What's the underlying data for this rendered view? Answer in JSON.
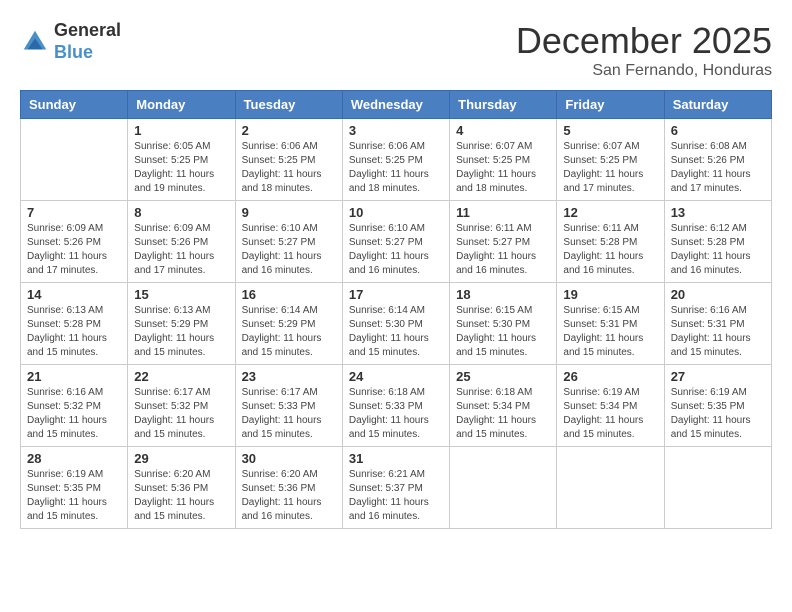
{
  "header": {
    "logo_general": "General",
    "logo_blue": "Blue",
    "month": "December 2025",
    "location": "San Fernando, Honduras"
  },
  "days_of_week": [
    "Sunday",
    "Monday",
    "Tuesday",
    "Wednesday",
    "Thursday",
    "Friday",
    "Saturday"
  ],
  "weeks": [
    [
      {
        "day": "",
        "sunrise": "",
        "sunset": "",
        "daylight": ""
      },
      {
        "day": "1",
        "sunrise": "Sunrise: 6:05 AM",
        "sunset": "Sunset: 5:25 PM",
        "daylight": "Daylight: 11 hours and 19 minutes."
      },
      {
        "day": "2",
        "sunrise": "Sunrise: 6:06 AM",
        "sunset": "Sunset: 5:25 PM",
        "daylight": "Daylight: 11 hours and 18 minutes."
      },
      {
        "day": "3",
        "sunrise": "Sunrise: 6:06 AM",
        "sunset": "Sunset: 5:25 PM",
        "daylight": "Daylight: 11 hours and 18 minutes."
      },
      {
        "day": "4",
        "sunrise": "Sunrise: 6:07 AM",
        "sunset": "Sunset: 5:25 PM",
        "daylight": "Daylight: 11 hours and 18 minutes."
      },
      {
        "day": "5",
        "sunrise": "Sunrise: 6:07 AM",
        "sunset": "Sunset: 5:25 PM",
        "daylight": "Daylight: 11 hours and 17 minutes."
      },
      {
        "day": "6",
        "sunrise": "Sunrise: 6:08 AM",
        "sunset": "Sunset: 5:26 PM",
        "daylight": "Daylight: 11 hours and 17 minutes."
      }
    ],
    [
      {
        "day": "7",
        "sunrise": "Sunrise: 6:09 AM",
        "sunset": "Sunset: 5:26 PM",
        "daylight": "Daylight: 11 hours and 17 minutes."
      },
      {
        "day": "8",
        "sunrise": "Sunrise: 6:09 AM",
        "sunset": "Sunset: 5:26 PM",
        "daylight": "Daylight: 11 hours and 17 minutes."
      },
      {
        "day": "9",
        "sunrise": "Sunrise: 6:10 AM",
        "sunset": "Sunset: 5:27 PM",
        "daylight": "Daylight: 11 hours and 16 minutes."
      },
      {
        "day": "10",
        "sunrise": "Sunrise: 6:10 AM",
        "sunset": "Sunset: 5:27 PM",
        "daylight": "Daylight: 11 hours and 16 minutes."
      },
      {
        "day": "11",
        "sunrise": "Sunrise: 6:11 AM",
        "sunset": "Sunset: 5:27 PM",
        "daylight": "Daylight: 11 hours and 16 minutes."
      },
      {
        "day": "12",
        "sunrise": "Sunrise: 6:11 AM",
        "sunset": "Sunset: 5:28 PM",
        "daylight": "Daylight: 11 hours and 16 minutes."
      },
      {
        "day": "13",
        "sunrise": "Sunrise: 6:12 AM",
        "sunset": "Sunset: 5:28 PM",
        "daylight": "Daylight: 11 hours and 16 minutes."
      }
    ],
    [
      {
        "day": "14",
        "sunrise": "Sunrise: 6:13 AM",
        "sunset": "Sunset: 5:28 PM",
        "daylight": "Daylight: 11 hours and 15 minutes."
      },
      {
        "day": "15",
        "sunrise": "Sunrise: 6:13 AM",
        "sunset": "Sunset: 5:29 PM",
        "daylight": "Daylight: 11 hours and 15 minutes."
      },
      {
        "day": "16",
        "sunrise": "Sunrise: 6:14 AM",
        "sunset": "Sunset: 5:29 PM",
        "daylight": "Daylight: 11 hours and 15 minutes."
      },
      {
        "day": "17",
        "sunrise": "Sunrise: 6:14 AM",
        "sunset": "Sunset: 5:30 PM",
        "daylight": "Daylight: 11 hours and 15 minutes."
      },
      {
        "day": "18",
        "sunrise": "Sunrise: 6:15 AM",
        "sunset": "Sunset: 5:30 PM",
        "daylight": "Daylight: 11 hours and 15 minutes."
      },
      {
        "day": "19",
        "sunrise": "Sunrise: 6:15 AM",
        "sunset": "Sunset: 5:31 PM",
        "daylight": "Daylight: 11 hours and 15 minutes."
      },
      {
        "day": "20",
        "sunrise": "Sunrise: 6:16 AM",
        "sunset": "Sunset: 5:31 PM",
        "daylight": "Daylight: 11 hours and 15 minutes."
      }
    ],
    [
      {
        "day": "21",
        "sunrise": "Sunrise: 6:16 AM",
        "sunset": "Sunset: 5:32 PM",
        "daylight": "Daylight: 11 hours and 15 minutes."
      },
      {
        "day": "22",
        "sunrise": "Sunrise: 6:17 AM",
        "sunset": "Sunset: 5:32 PM",
        "daylight": "Daylight: 11 hours and 15 minutes."
      },
      {
        "day": "23",
        "sunrise": "Sunrise: 6:17 AM",
        "sunset": "Sunset: 5:33 PM",
        "daylight": "Daylight: 11 hours and 15 minutes."
      },
      {
        "day": "24",
        "sunrise": "Sunrise: 6:18 AM",
        "sunset": "Sunset: 5:33 PM",
        "daylight": "Daylight: 11 hours and 15 minutes."
      },
      {
        "day": "25",
        "sunrise": "Sunrise: 6:18 AM",
        "sunset": "Sunset: 5:34 PM",
        "daylight": "Daylight: 11 hours and 15 minutes."
      },
      {
        "day": "26",
        "sunrise": "Sunrise: 6:19 AM",
        "sunset": "Sunset: 5:34 PM",
        "daylight": "Daylight: 11 hours and 15 minutes."
      },
      {
        "day": "27",
        "sunrise": "Sunrise: 6:19 AM",
        "sunset": "Sunset: 5:35 PM",
        "daylight": "Daylight: 11 hours and 15 minutes."
      }
    ],
    [
      {
        "day": "28",
        "sunrise": "Sunrise: 6:19 AM",
        "sunset": "Sunset: 5:35 PM",
        "daylight": "Daylight: 11 hours and 15 minutes."
      },
      {
        "day": "29",
        "sunrise": "Sunrise: 6:20 AM",
        "sunset": "Sunset: 5:36 PM",
        "daylight": "Daylight: 11 hours and 15 minutes."
      },
      {
        "day": "30",
        "sunrise": "Sunrise: 6:20 AM",
        "sunset": "Sunset: 5:36 PM",
        "daylight": "Daylight: 11 hours and 16 minutes."
      },
      {
        "day": "31",
        "sunrise": "Sunrise: 6:21 AM",
        "sunset": "Sunset: 5:37 PM",
        "daylight": "Daylight: 11 hours and 16 minutes."
      },
      {
        "day": "",
        "sunrise": "",
        "sunset": "",
        "daylight": ""
      },
      {
        "day": "",
        "sunrise": "",
        "sunset": "",
        "daylight": ""
      },
      {
        "day": "",
        "sunrise": "",
        "sunset": "",
        "daylight": ""
      }
    ]
  ]
}
